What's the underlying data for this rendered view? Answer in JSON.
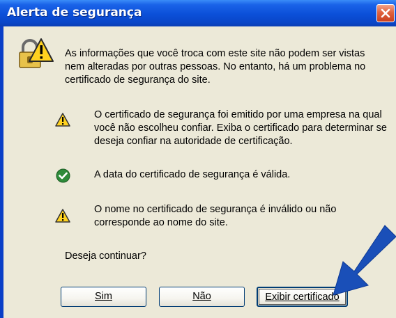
{
  "window": {
    "title": "Alerta de segurança"
  },
  "message": {
    "intro": "As informações que você troca com este site não podem ser vistas nem alteradas por outras pessoas. No entanto, há um problema no certificado de segurança do site."
  },
  "checks": [
    {
      "status": "warning",
      "icon": "warning-icon",
      "text": "O certificado de segurança foi emitido por uma empresa na qual você não escolheu confiar. Exiba o certificado para determinar se deseja confiar na autoridade de certificação."
    },
    {
      "status": "ok",
      "icon": "check-icon",
      "text": "A data do certificado de segurança é válida."
    },
    {
      "status": "warning",
      "icon": "warning-icon",
      "text": "O nome no certificado de segurança é inválido ou não corresponde ao nome do site."
    }
  ],
  "prompt": "Deseja continuar?",
  "buttons": {
    "yes": "Sim",
    "no": "Não",
    "view_certificate": "Exibir certificado"
  },
  "colors": {
    "titlebar": "#0b4fd8",
    "dialog_background": "#ece9d8",
    "close_button": "#e0633f",
    "arrow": "#1a4fb8"
  }
}
